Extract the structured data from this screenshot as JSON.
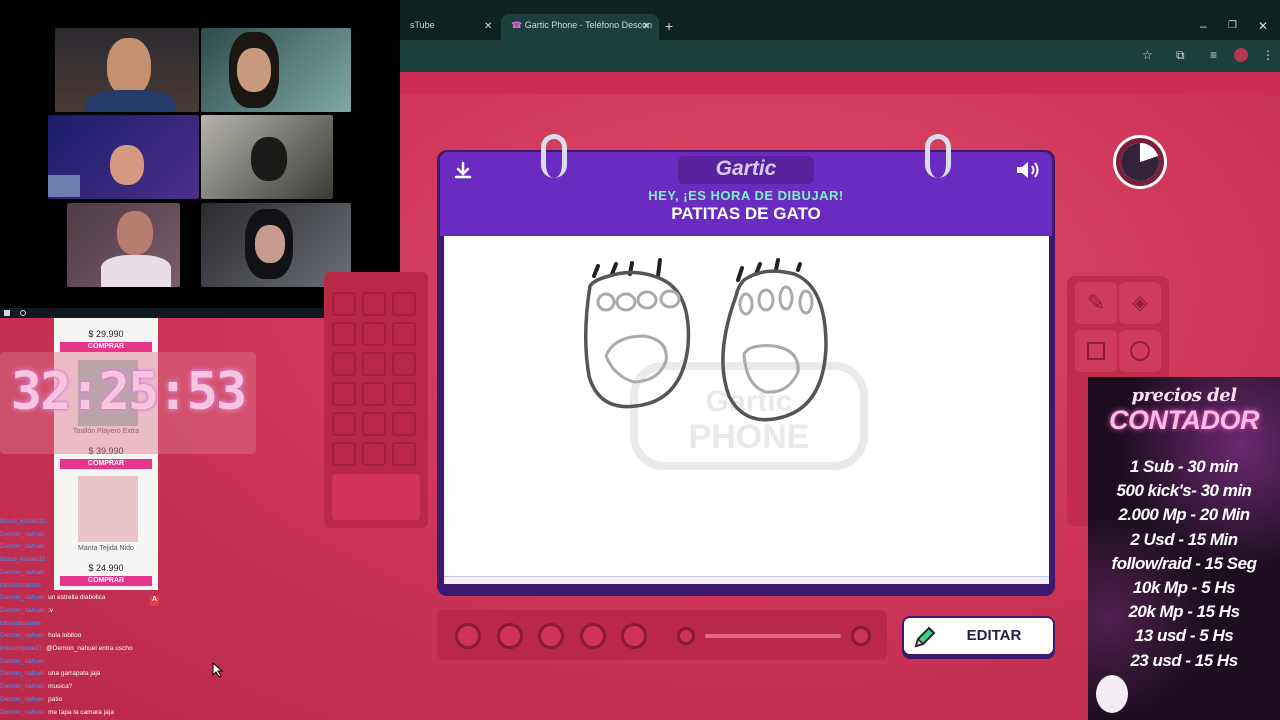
{
  "browser": {
    "tabs": [
      {
        "label": "sTube",
        "active": false
      },
      {
        "label": "Gartic Phone - Teléfono Descon",
        "active": true
      }
    ],
    "new_tab_icon": "plus-icon",
    "window_controls": [
      "minimize-icon",
      "restore-icon",
      "close-icon"
    ]
  },
  "shop": {
    "items": [
      {
        "price": "$ 29.990",
        "button": "COMPRAR"
      },
      {
        "name": "Toallón Playero Extra",
        "price": "$ 39.990",
        "button": "COMPRAR"
      },
      {
        "name": "Manta Tejida Nido",
        "price": "$ 24.990",
        "button": "COMPRAR"
      }
    ]
  },
  "timer": {
    "value": "32:25:53"
  },
  "chat": [
    {
      "user": "Blood_kisses32",
      "msg": ""
    },
    {
      "user": "Demon_nahuel",
      "msg": ""
    },
    {
      "user": "Demon_nahuel",
      "msg": ""
    },
    {
      "user": "Blood_kisses32",
      "msg": ""
    },
    {
      "user": "Demon_nahuel",
      "msg": ""
    },
    {
      "user": "lobitodesarme",
      "msg": ""
    },
    {
      "user": "Demon_nahuel",
      "msg": "un estrella diabolica"
    },
    {
      "user": "Demon_nahuel",
      "msg": ":v"
    },
    {
      "user": "lobitodesarme",
      "msg": ""
    },
    {
      "user": "Demon_nahuel",
      "msg": "hola lobitoo"
    },
    {
      "user": "milaconpure11",
      "msg": "@Demon_nahuel entra uscho"
    },
    {
      "user": "Demon_nahuel",
      "msg": ""
    },
    {
      "user": "Demon_nahuel",
      "msg": "una garrapata jaja"
    },
    {
      "user": "Demon_nahuel",
      "msg": "musica?"
    },
    {
      "user": "Demon_nahuel",
      "msg": "patio"
    },
    {
      "user": "Demon_nahuel",
      "msg": "me tapa la camara jaja"
    }
  ],
  "game": {
    "logo": "Gartic",
    "subtitle": "HEY, ¡ES HORA DE DIBUJAR!",
    "prompt": "PATITAS DE GATO",
    "watermark": "Gartic Phone",
    "edit_button": "EDITAR",
    "icons": {
      "download": "download-icon",
      "sound": "speaker-icon",
      "timer": "timer-icon",
      "pencil": "pencil-icon"
    },
    "accent": "#6a2cc0"
  },
  "promo": {
    "title_small": "precios del",
    "title_big": "CONTADOR",
    "lines": [
      "1 Sub - 30 min",
      "500 kick's- 30 min",
      "2.000 Mp - 20 Min",
      "2 Usd - 15 Min",
      "follow/raid - 15 Seg",
      "10k Mp - 5 Hs",
      "20k Mp - 15 Hs",
      "13 usd - 5 Hs",
      "23 usd - 15 Hs"
    ]
  }
}
